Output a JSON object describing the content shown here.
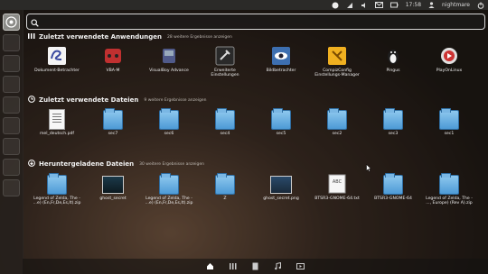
{
  "topbar": {
    "time": "17:58",
    "user": "nightmare",
    "indicators": [
      "ubuntu-one-icon",
      "network-icon",
      "sound-icon",
      "mail-icon",
      "battery-icon"
    ]
  },
  "launcher": {
    "items": [
      "dash-home-icon",
      "app-icon",
      "app-icon",
      "app-icon",
      "app-icon",
      "app-icon",
      "app-icon",
      "app-icon",
      "app-icon"
    ]
  },
  "search": {
    "value": "",
    "placeholder": ""
  },
  "sections": {
    "apps": {
      "title": "Zuletzt verwendete Anwendungen",
      "more": "28 weitere Ergebnisse anzeigen",
      "items": [
        {
          "label": "Dokument-Betrachter",
          "icon": "document-viewer-icon"
        },
        {
          "label": "VBA-M",
          "icon": "vbam-icon"
        },
        {
          "label": "VisualBoy Advance",
          "icon": "visualboy-icon"
        },
        {
          "label": "Erweiterte\nEinstellungen",
          "icon": "advanced-settings-icon"
        },
        {
          "label": "Bildbetrachter",
          "icon": "image-viewer-icon"
        },
        {
          "label": "CompizConfig\nEinstellungs-Manager",
          "icon": "compizconfig-icon"
        },
        {
          "label": "Pingus",
          "icon": "pingus-icon"
        },
        {
          "label": "PlayOnLinux",
          "icon": "playonlinux-icon"
        }
      ]
    },
    "files": {
      "title": "Zuletzt verwendete Dateien",
      "more": "9 weitere Ergebnisse anzeigen",
      "items": [
        {
          "label": "mel_deutsch.pdf",
          "icon": "pdf-document-icon"
        },
        {
          "label": "sec7",
          "icon": "folder-icon"
        },
        {
          "label": "sec6",
          "icon": "folder-icon"
        },
        {
          "label": "sec4",
          "icon": "folder-icon"
        },
        {
          "label": "sec5",
          "icon": "folder-icon"
        },
        {
          "label": "sec2",
          "icon": "folder-icon"
        },
        {
          "label": "sec3",
          "icon": "folder-icon"
        },
        {
          "label": "sec1",
          "icon": "folder-icon"
        }
      ]
    },
    "downloads": {
      "title": "Heruntergeladene Dateien",
      "more": "30 weitere Ergebnisse anzeigen",
      "items": [
        {
          "label": "Legend of Zelda, The -\n...e) (En,Fr,De,Es,It).zip",
          "icon": "zip-file-icon"
        },
        {
          "label": "ghost_secret",
          "icon": "image-thumbnail-icon"
        },
        {
          "label": "Legend of Zelda, The -\n...e) (En,Fr,De,Es,It).zip",
          "icon": "zip-file-icon"
        },
        {
          "label": "Z",
          "icon": "folder-icon"
        },
        {
          "label": "ghost_secret.png",
          "icon": "image-thumbnail-icon"
        },
        {
          "label": "BTSR3-GNOME-64.txt",
          "icon": "text-file-icon"
        },
        {
          "label": "BTSR3-GNOME-64",
          "icon": "folder-icon"
        },
        {
          "label": "Legend of Zelda, The -\n..., Europe) (Rev A).zip",
          "icon": "zip-file-icon"
        }
      ]
    }
  },
  "lenses": [
    "home-lens-icon",
    "applications-lens-icon",
    "files-lens-icon",
    "music-lens-icon",
    "video-lens-icon"
  ],
  "colors": {
    "folder": "#5aa6df",
    "accent": "#f07746"
  }
}
